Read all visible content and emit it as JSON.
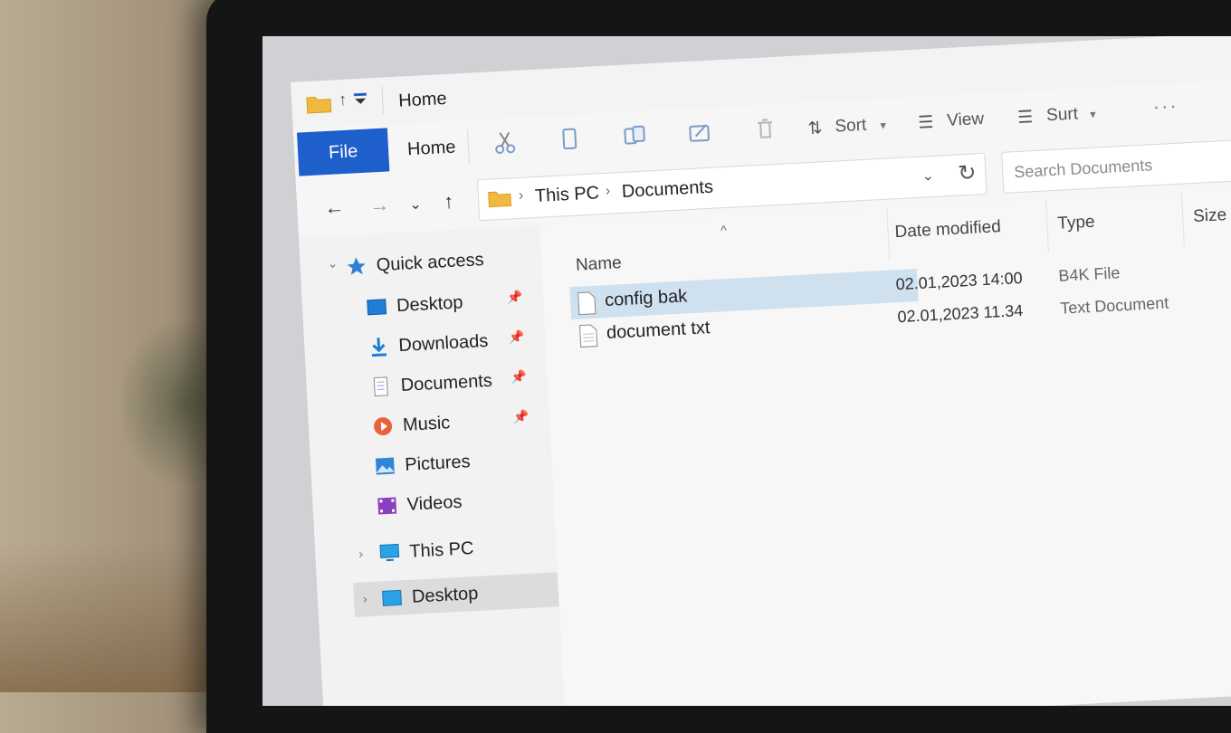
{
  "window": {
    "title": "Home"
  },
  "ribbon": {
    "file_tab": "File",
    "home_tab": "Home",
    "sort_label": "Sort",
    "view_label": "View",
    "sort2_label": "Surt",
    "more": "···"
  },
  "address": {
    "crumbs": [
      "This PC",
      "Documents"
    ]
  },
  "search": {
    "placeholder": "Search Documents"
  },
  "sidebar": {
    "quick_access": "Quick access",
    "items": [
      {
        "label": "Desktop",
        "icon": "desktop-icon"
      },
      {
        "label": "Downloads",
        "icon": "download-icon"
      },
      {
        "label": "Documents",
        "icon": "document-icon"
      },
      {
        "label": "Music",
        "icon": "music-icon"
      },
      {
        "label": "Pictures",
        "icon": "pictures-icon"
      },
      {
        "label": "Videos",
        "icon": "videos-icon"
      }
    ],
    "this_pc": "This PC",
    "desktop_bottom": "Desktop"
  },
  "columns": {
    "name": "Name",
    "date": "Date modified",
    "type": "Type",
    "size": "Size"
  },
  "files": [
    {
      "name": "config bak",
      "date": "02.01,2023 14:00",
      "type": "B4K File"
    },
    {
      "name": "document txt",
      "date": "02.01,2023 11.34",
      "type": "Text Document"
    }
  ],
  "colors": {
    "accent": "#1e5fcc",
    "selection": "#cfe0ef",
    "folder": "#f2b941"
  }
}
